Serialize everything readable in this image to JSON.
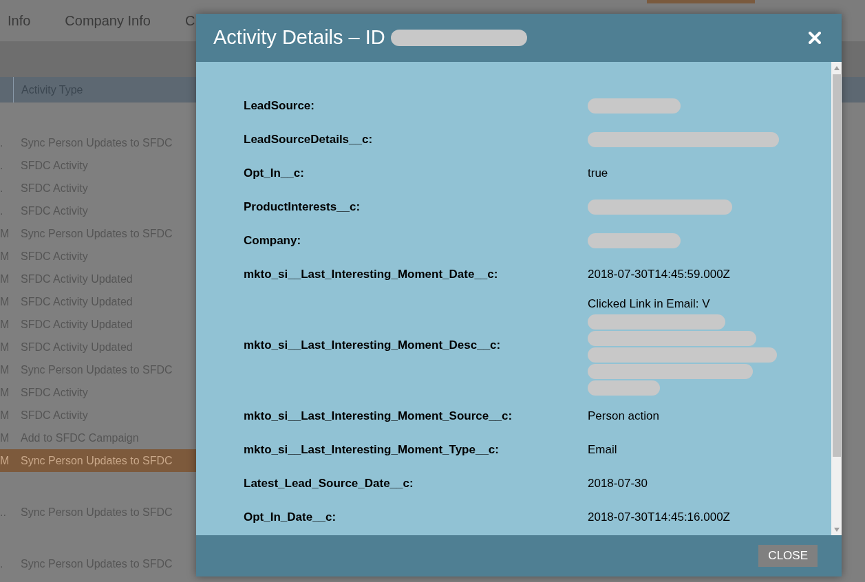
{
  "tabs": [
    {
      "label": "Info"
    },
    {
      "label": "Company Info"
    },
    {
      "label": "C"
    }
  ],
  "table": {
    "columns": [
      "Activity Type"
    ],
    "groups": [
      {
        "rows": [
          {
            "prefix": ".",
            "type": "Sync Person Updates to SFDC",
            "selected": false
          },
          {
            "prefix": ".",
            "type": "SFDC Activity",
            "selected": false
          },
          {
            "prefix": ".",
            "type": "SFDC Activity",
            "selected": false
          },
          {
            "prefix": ".",
            "type": "SFDC Activity",
            "selected": false
          },
          {
            "prefix": "M",
            "type": "Sync Person Updates to SFDC",
            "selected": false
          },
          {
            "prefix": "M",
            "type": "SFDC Activity",
            "selected": false
          },
          {
            "prefix": "M",
            "type": "SFDC Activity Updated",
            "selected": false
          },
          {
            "prefix": "M",
            "type": "SFDC Activity Updated",
            "selected": false
          },
          {
            "prefix": "M",
            "type": "SFDC Activity Updated",
            "selected": false
          },
          {
            "prefix": "M",
            "type": "SFDC Activity Updated",
            "selected": false
          },
          {
            "prefix": "M",
            "type": "Sync Person Updates to SFDC",
            "selected": false
          },
          {
            "prefix": "M",
            "type": "SFDC Activity",
            "selected": false
          },
          {
            "prefix": "M",
            "type": "SFDC Activity",
            "selected": false
          },
          {
            "prefix": "M",
            "type": "Add to SFDC Campaign",
            "selected": false
          },
          {
            "prefix": "M",
            "type": "Sync Person Updates to SFDC",
            "selected": true
          }
        ]
      },
      {
        "rows": [
          {
            "prefix": "..",
            "type": "Sync Person Updates to SFDC",
            "selected": false
          }
        ]
      },
      {
        "rows": [
          {
            "prefix": ".",
            "type": "Sync Person Updates to SFDC",
            "selected": false
          }
        ]
      }
    ]
  },
  "dialog": {
    "title": "Activity Details – ID",
    "title_redacted": true,
    "fields": [
      {
        "label": "LeadSource:",
        "redacted": true
      },
      {
        "label": "LeadSourceDetails__c:",
        "redacted": true
      },
      {
        "label": "Opt_In__c:",
        "value": "true",
        "redacted": false
      },
      {
        "label": "ProductInterests__c:",
        "redacted": true
      },
      {
        "label": "Company:",
        "redacted": true
      },
      {
        "label": "mkto_si__Last_Interesting_Moment_Date__c:",
        "value": "2018-07-30T14:45:59.000Z",
        "redacted": false
      },
      {
        "label": "mkto_si__Last_Interesting_Moment_Desc__c:",
        "value": "Clicked Link in Email: V",
        "redacted": true
      },
      {
        "label": "mkto_si__Last_Interesting_Moment_Source__c:",
        "value": "Person action",
        "redacted": false
      },
      {
        "label": "mkto_si__Last_Interesting_Moment_Type__c:",
        "value": "Email",
        "redacted": false
      },
      {
        "label": "Latest_Lead_Source_Date__c:",
        "value": "2018-07-30",
        "redacted": false
      },
      {
        "label": "Opt_In_Date__c:",
        "value": "2018-07-30T14:45:16.000Z",
        "redacted": false
      }
    ],
    "close_button": "CLOSE"
  }
}
